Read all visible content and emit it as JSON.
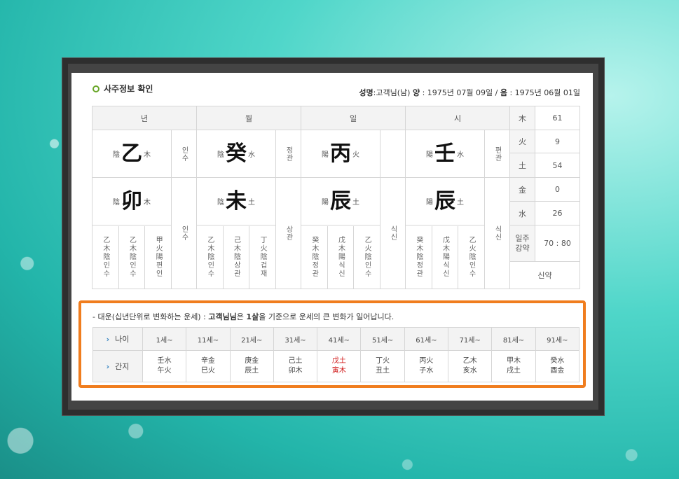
{
  "section_title": "사주정보 확인",
  "info": {
    "name_label": "성명",
    "name_value": ":고객님(남)",
    "solar_label": "양",
    "solar_value": ": 1975년 07월 09일 /",
    "lunar_label": "음",
    "lunar_value": ": 1975년 06월 01일"
  },
  "pillars": {
    "year": {
      "header": "년",
      "stem": {
        "yy": "陰",
        "char": "乙",
        "el": "木"
      },
      "stem_rel": "인수",
      "branch": {
        "yy": "陰",
        "char": "卯",
        "el": "木"
      },
      "branch_rel": "인수",
      "hidden": [
        "乙木陰인수",
        "乙木陰인수",
        "甲火陽편인"
      ]
    },
    "month": {
      "header": "월",
      "stem": {
        "yy": "陰",
        "char": "癸",
        "el": "水"
      },
      "stem_rel": "정관",
      "branch": {
        "yy": "陰",
        "char": "未",
        "el": "土"
      },
      "branch_rel": "상관",
      "hidden": [
        "乙木陰인수",
        "己木陰상관",
        "丁火陰겁재"
      ]
    },
    "day": {
      "header": "일",
      "stem": {
        "yy": "陽",
        "char": "丙",
        "el": "火"
      },
      "stem_rel": "",
      "branch": {
        "yy": "陽",
        "char": "辰",
        "el": "土"
      },
      "branch_rel": "식신",
      "hidden": [
        "癸木陰정관",
        "戊木陽식신",
        "乙火陰인수"
      ]
    },
    "hour": {
      "header": "시",
      "stem": {
        "yy": "陽",
        "char": "壬",
        "el": "水"
      },
      "stem_rel": "편관",
      "branch": {
        "yy": "陽",
        "char": "辰",
        "el": "土"
      },
      "branch_rel": "식신",
      "hidden": [
        "癸木陰정관",
        "戊木陽식신",
        "乙火陰인수"
      ]
    }
  },
  "ohang": [
    {
      "label": "木",
      "value": "61"
    },
    {
      "label": "火",
      "value": "9"
    },
    {
      "label": "土",
      "value": "54"
    },
    {
      "label": "金",
      "value": "0"
    },
    {
      "label": "水",
      "value": "26"
    }
  ],
  "strength": {
    "label": "일주\n강약",
    "value": "70 : 80",
    "verdict": "신약"
  },
  "daeun": {
    "note_prefix": "- 대운(십년단위로 변화하는 운세) : ",
    "note_name": "고객님님",
    "note_mid": "은 ",
    "note_age": "1살",
    "note_suffix": "을 기준으로 운세의 큰 변화가 일어납니다.",
    "age_label": "나이",
    "gz_label": "간지",
    "ages": [
      "1세~",
      "11세~",
      "21세~",
      "31세~",
      "41세~",
      "51세~",
      "61세~",
      "71세~",
      "81세~",
      "91세~"
    ],
    "ganji": [
      {
        "top": "壬水",
        "bottom": "午火"
      },
      {
        "top": "辛金",
        "bottom": "巳火"
      },
      {
        "top": "庚金",
        "bottom": "辰土"
      },
      {
        "top": "己土",
        "bottom": "卯木"
      },
      {
        "top": "戊土",
        "bottom": "寅木"
      },
      {
        "top": "丁火",
        "bottom": "丑土"
      },
      {
        "top": "丙火",
        "bottom": "子水"
      },
      {
        "top": "乙木",
        "bottom": "亥水"
      },
      {
        "top": "甲木",
        "bottom": "戌土"
      },
      {
        "top": "癸水",
        "bottom": "酉金"
      }
    ]
  },
  "highlight_color": "#d01818",
  "border_color": "#f07d1e"
}
